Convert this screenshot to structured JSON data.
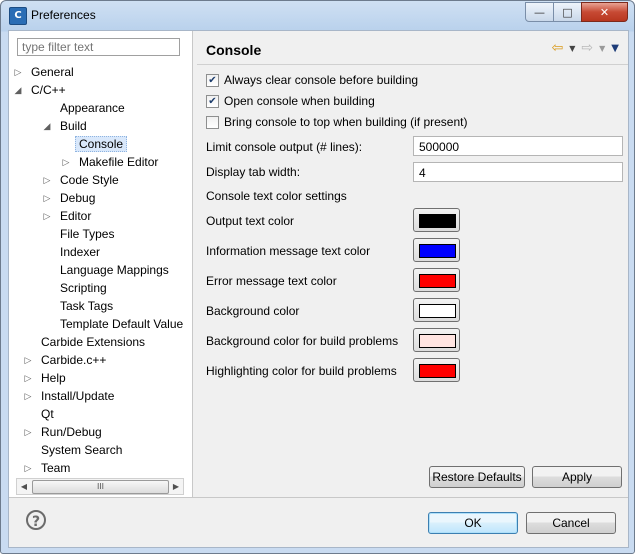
{
  "window": {
    "title": "Preferences",
    "app_icon": "eclipse-c-icon",
    "minimize": "—",
    "maximize": "□",
    "close": "✕"
  },
  "sidebar": {
    "filter_placeholder": "type filter text",
    "items": [
      {
        "label": "General",
        "twisty": "▷"
      },
      {
        "label": "C/C++",
        "twisty": "◢"
      },
      {
        "label": "Appearance",
        "twisty": ""
      },
      {
        "label": "Build",
        "twisty": "◢"
      },
      {
        "label": "Console",
        "twisty": ""
      },
      {
        "label": "Makefile Editor",
        "twisty": "▷"
      },
      {
        "label": "Code Style",
        "twisty": "▷"
      },
      {
        "label": "Debug",
        "twisty": "▷"
      },
      {
        "label": "Editor",
        "twisty": "▷"
      },
      {
        "label": "File Types",
        "twisty": ""
      },
      {
        "label": "Indexer",
        "twisty": ""
      },
      {
        "label": "Language Mappings",
        "twisty": ""
      },
      {
        "label": "Scripting",
        "twisty": ""
      },
      {
        "label": "Task Tags",
        "twisty": ""
      },
      {
        "label": "Template Default Value",
        "twisty": ""
      },
      {
        "label": "Carbide Extensions",
        "twisty": ""
      },
      {
        "label": "Carbide.c++",
        "twisty": "▷"
      },
      {
        "label": "Help",
        "twisty": "▷"
      },
      {
        "label": "Install/Update",
        "twisty": "▷"
      },
      {
        "label": "Qt",
        "twisty": ""
      },
      {
        "label": "Run/Debug",
        "twisty": "▷"
      },
      {
        "label": "System Search",
        "twisty": ""
      },
      {
        "label": "Team",
        "twisty": "▷"
      }
    ],
    "scroll_left": "◀",
    "scroll_right": "▶",
    "scroll_grip": "III"
  },
  "page": {
    "title": "Console",
    "nav": {
      "back": "⇦",
      "dropdown": "▼",
      "forward": "⇨",
      "menu": "▼"
    },
    "options": [
      {
        "label": "Always clear console before building",
        "checked": "✔"
      },
      {
        "label": "Open console when building",
        "checked": "✔"
      },
      {
        "label": "Bring console to top when building (if present)",
        "checked": ""
      }
    ],
    "limit_label": "Limit console output (# lines):",
    "limit_value": "500000",
    "tab_label": "Display tab width:",
    "tab_value": "4",
    "color_section": "Console text color settings",
    "colors": [
      {
        "label": "Output text color",
        "value": "#000000"
      },
      {
        "label": "Information message text color",
        "value": "#0000ff"
      },
      {
        "label": "Error message text color",
        "value": "#ff0000"
      },
      {
        "label": "Background color",
        "value": "#ffffff"
      },
      {
        "label": "Background color for build problems",
        "value": "#ffe4e1"
      },
      {
        "label": "Highlighting color for build problems",
        "value": "#ff0000"
      }
    ],
    "restore_defaults": "Restore Defaults",
    "apply": "Apply"
  },
  "footer": {
    "help": "?",
    "ok": "OK",
    "cancel": "Cancel"
  }
}
